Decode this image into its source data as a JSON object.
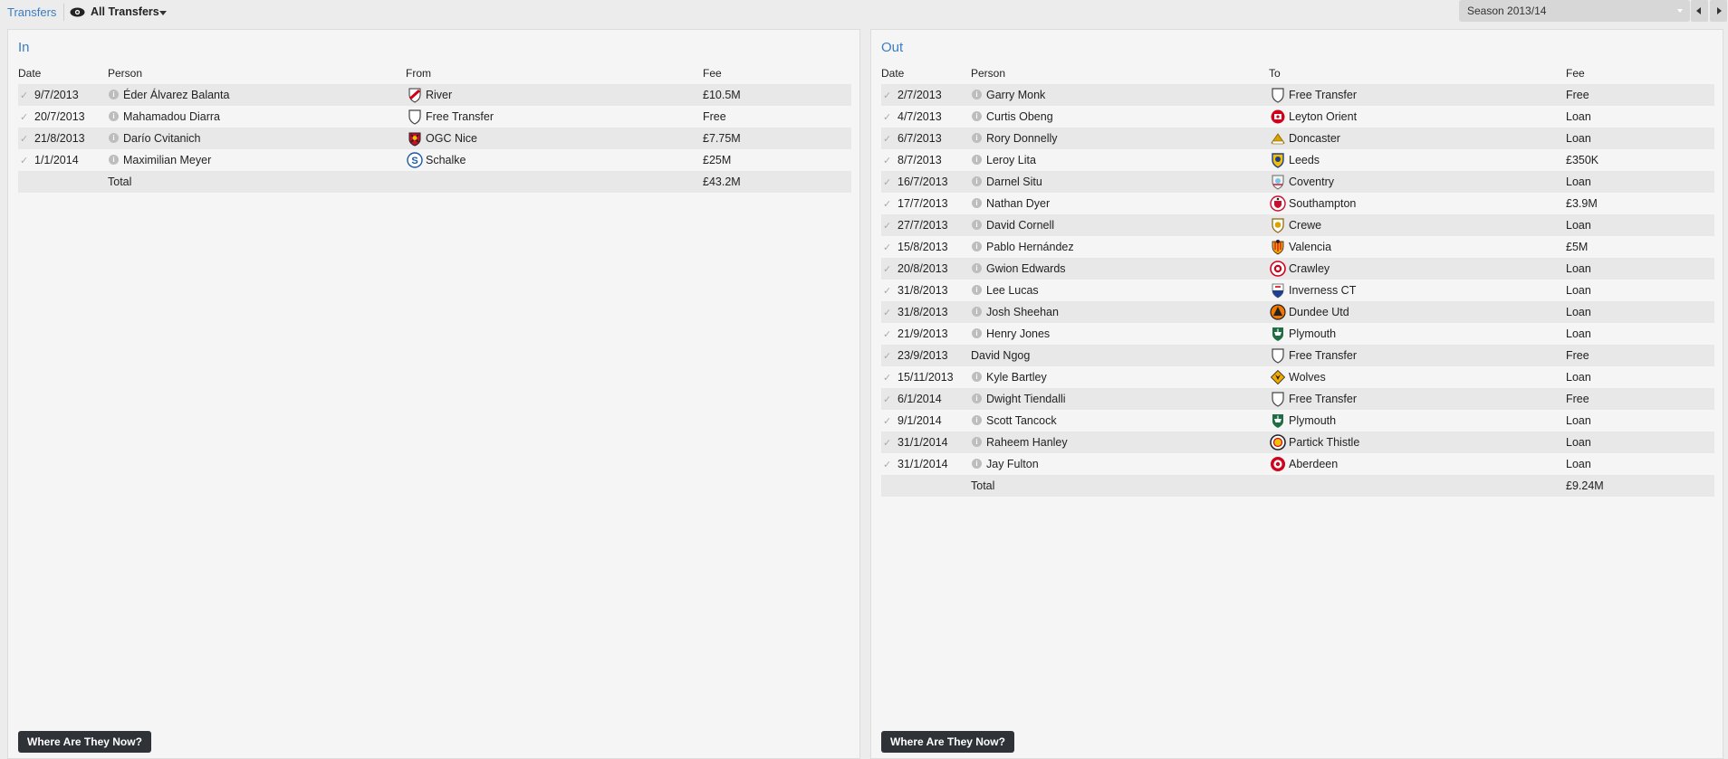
{
  "topbar": {
    "link": "Transfers",
    "filter": "All Transfers",
    "season": "Season 2013/14"
  },
  "in_panel": {
    "title": "In",
    "headers": {
      "date": "Date",
      "person": "Person",
      "club": "From",
      "fee": "Fee"
    },
    "rows": [
      {
        "date": "9/7/2013",
        "person": "Éder Álvarez Balanta",
        "club": "River",
        "fee": "£10.5M",
        "badge": "river"
      },
      {
        "date": "20/7/2013",
        "person": "Mahamadou Diarra",
        "club": "Free Transfer",
        "fee": "Free",
        "badge": "free"
      },
      {
        "date": "21/8/2013",
        "person": "Darío Cvitanich",
        "club": "OGC Nice",
        "fee": "£7.75M",
        "badge": "nice"
      },
      {
        "date": "1/1/2014",
        "person": "Maximilian Meyer",
        "club": "Schalke",
        "fee": "£25M",
        "badge": "schalke"
      }
    ],
    "total_label": "Total",
    "total_fee": "£43.2M",
    "button": "Where Are They Now?"
  },
  "out_panel": {
    "title": "Out",
    "headers": {
      "date": "Date",
      "person": "Person",
      "club": "To",
      "fee": "Fee"
    },
    "rows": [
      {
        "date": "2/7/2013",
        "person": "Garry Monk",
        "club": "Free Transfer",
        "fee": "Free",
        "badge": "free",
        "info": true
      },
      {
        "date": "4/7/2013",
        "person": "Curtis Obeng",
        "club": "Leyton Orient",
        "fee": "Loan",
        "badge": "leyton",
        "info": true
      },
      {
        "date": "6/7/2013",
        "person": "Rory Donnelly",
        "club": "Doncaster",
        "fee": "Loan",
        "badge": "doncaster",
        "info": true
      },
      {
        "date": "8/7/2013",
        "person": "Leroy Lita",
        "club": "Leeds",
        "fee": "£350K",
        "badge": "leeds",
        "info": true
      },
      {
        "date": "16/7/2013",
        "person": "Darnel Situ",
        "club": "Coventry",
        "fee": "Loan",
        "badge": "coventry",
        "info": true
      },
      {
        "date": "17/7/2013",
        "person": "Nathan Dyer",
        "club": "Southampton",
        "fee": "£3.9M",
        "badge": "southampton",
        "info": true
      },
      {
        "date": "27/7/2013",
        "person": "David Cornell",
        "club": "Crewe",
        "fee": "Loan",
        "badge": "crewe",
        "info": true
      },
      {
        "date": "15/8/2013",
        "person": "Pablo Hernández",
        "club": "Valencia",
        "fee": "£5M",
        "badge": "valencia",
        "info": true
      },
      {
        "date": "20/8/2013",
        "person": "Gwion Edwards",
        "club": "Crawley",
        "fee": "Loan",
        "badge": "crawley",
        "info": true
      },
      {
        "date": "31/8/2013",
        "person": "Lee Lucas",
        "club": "Inverness CT",
        "fee": "Loan",
        "badge": "inverness",
        "info": true
      },
      {
        "date": "31/8/2013",
        "person": "Josh Sheehan",
        "club": "Dundee Utd",
        "fee": "Loan",
        "badge": "dundee",
        "info": true
      },
      {
        "date": "21/9/2013",
        "person": "Henry Jones",
        "club": "Plymouth",
        "fee": "Loan",
        "badge": "plymouth",
        "info": true
      },
      {
        "date": "23/9/2013",
        "person": "David Ngog",
        "club": "Free Transfer",
        "fee": "Free",
        "badge": "free",
        "info": false
      },
      {
        "date": "15/11/2013",
        "person": "Kyle Bartley",
        "club": "Wolves",
        "fee": "Loan",
        "badge": "wolves",
        "info": true
      },
      {
        "date": "6/1/2014",
        "person": "Dwight Tiendalli",
        "club": "Free Transfer",
        "fee": "Free",
        "badge": "free",
        "info": true
      },
      {
        "date": "9/1/2014",
        "person": "Scott Tancock",
        "club": "Plymouth",
        "fee": "Loan",
        "badge": "plymouth",
        "info": true
      },
      {
        "date": "31/1/2014",
        "person": "Raheem Hanley",
        "club": "Partick Thistle",
        "fee": "Loan",
        "badge": "partick",
        "info": true
      },
      {
        "date": "31/1/2014",
        "person": "Jay Fulton",
        "club": "Aberdeen",
        "fee": "Loan",
        "badge": "aberdeen",
        "info": true
      }
    ],
    "total_label": "Total",
    "total_fee": "£9.24M",
    "button": "Where Are They Now?"
  },
  "colors": {
    "accent": "#3a7dc4",
    "panel": "#f5f5f5",
    "row_alt": "#e8e8e8",
    "button": "#2f3337"
  }
}
